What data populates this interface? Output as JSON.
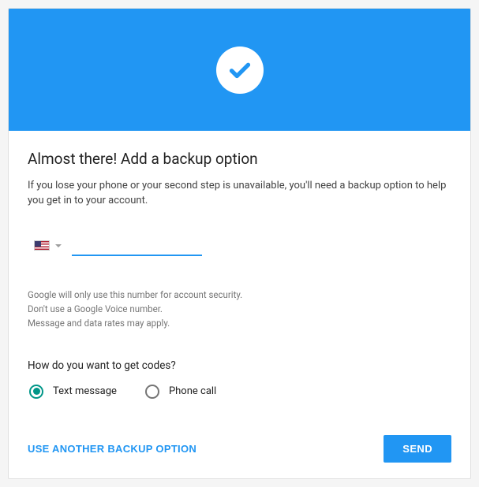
{
  "banner": {
    "icon": "checkmark-icon"
  },
  "title": "Almost there! Add a backup option",
  "description": "If you lose your phone or your second step is unavailable, you'll need a backup option to help you get in to your account.",
  "phone": {
    "country": "US",
    "value": ""
  },
  "disclaimer": {
    "line1": "Google will only use this number for account security.",
    "line2": "Don't use a Google Voice number.",
    "line3": "Message and data rates may apply."
  },
  "codes_question": "How do you want to get codes?",
  "radio_options": {
    "text_message": {
      "label": "Text message",
      "selected": true
    },
    "phone_call": {
      "label": "Phone call",
      "selected": false
    }
  },
  "actions": {
    "alternative": "USE ANOTHER BACKUP OPTION",
    "submit": "SEND"
  }
}
